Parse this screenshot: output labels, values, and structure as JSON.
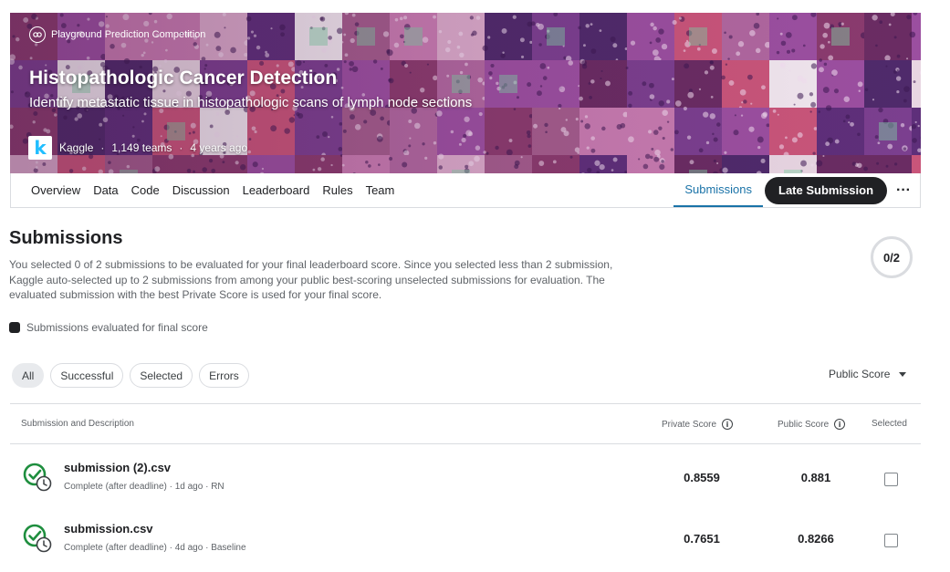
{
  "banner": {
    "competition_type": "Playground Prediction Competition",
    "title": "Histopathologic Cancer Detection",
    "subtitle": "Identify metastatic tissue in histopathologic scans of lymph node sections",
    "host": "Kaggle",
    "teams": "1,149 teams",
    "age": "4 years ago",
    "separator": "·",
    "logo_letter": "k"
  },
  "tabs": [
    "Overview",
    "Data",
    "Code",
    "Discussion",
    "Leaderboard",
    "Rules",
    "Team"
  ],
  "active_tab": "Submissions",
  "late_submission_label": "Late Submission",
  "more_label": "···",
  "submissions": {
    "title": "Submissions",
    "description": "You selected 0 of 2 submissions to be evaluated for your final leaderboard score. Since you selected less than 2 submission, Kaggle auto-selected up to 2 submissions from among your public best-scoring unselected submissions for evaluation. The evaluated submission with the best Private Score is used for your final score.",
    "selected_count": "0/2",
    "legend": "Submissions evaluated for final score"
  },
  "filters": [
    "All",
    "Successful",
    "Selected",
    "Errors"
  ],
  "active_filter": "All",
  "sort_label": "Public Score",
  "columns": {
    "submission": "Submission and Description",
    "private": "Private Score",
    "public": "Public Score",
    "selected": "Selected"
  },
  "rows": [
    {
      "name": "submission (2).csv",
      "meta": "Complete (after deadline) · 1d ago · RN",
      "private": "0.8559",
      "public": "0.881",
      "selected": false
    },
    {
      "name": "submission.csv",
      "meta": "Complete (after deadline) · 4d ago · Baseline",
      "private": "0.7651",
      "public": "0.8266",
      "selected": false
    }
  ],
  "colors": {
    "accent": "#1a73a8",
    "dark_button": "#202124",
    "success_green": "#1e8e3e"
  }
}
